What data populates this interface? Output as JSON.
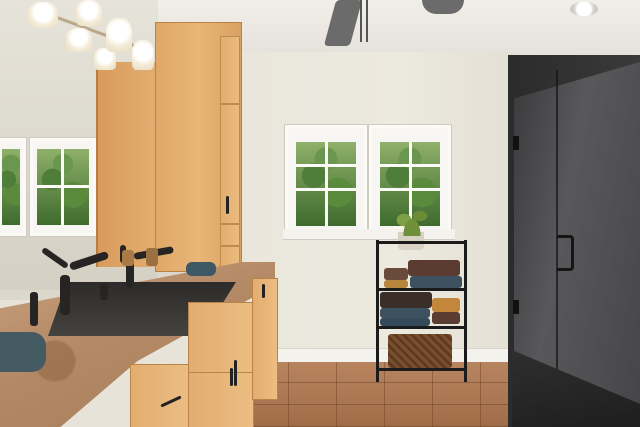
{
  "scene": {
    "subject": "",
    "palette": {
      "wall": "#e9e6dc",
      "cabinet_wood": "#e3ae72",
      "countertop": "#b58a66",
      "sink": "#333230",
      "shower_glass": "#4a4a4c",
      "floor_tile": "#a87452",
      "fixture_metal": "#1b1b1b"
    },
    "icons": {
      "light": "bulb-icon",
      "fan": "ceiling-fan-icon",
      "plant": "plant-icon",
      "towel": "towel-icon"
    }
  }
}
